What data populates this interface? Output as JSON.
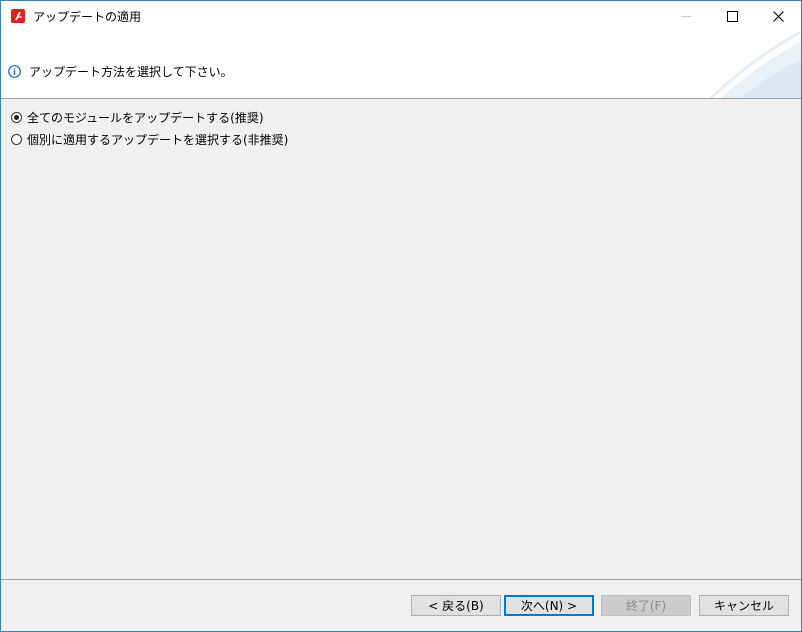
{
  "window": {
    "title": "アップデートの適用",
    "icon": "app-logo-icon"
  },
  "banner": {
    "message": "アップデート方法を選択して下さい。",
    "icon": "info-icon"
  },
  "options": [
    {
      "label": "全てのモジュールをアップデートする(推奨)",
      "selected": true
    },
    {
      "label": "個別に適用するアップデートを選択する(非推奨)",
      "selected": false
    }
  ],
  "buttons": {
    "back": "< 戻る(B)",
    "next": "次へ(N) >",
    "finish": "終了(F)",
    "cancel": "キャンセル"
  },
  "colors": {
    "accent": "#0078d7",
    "window_border": "#3c7fb1",
    "app_icon": "#d9261c"
  }
}
